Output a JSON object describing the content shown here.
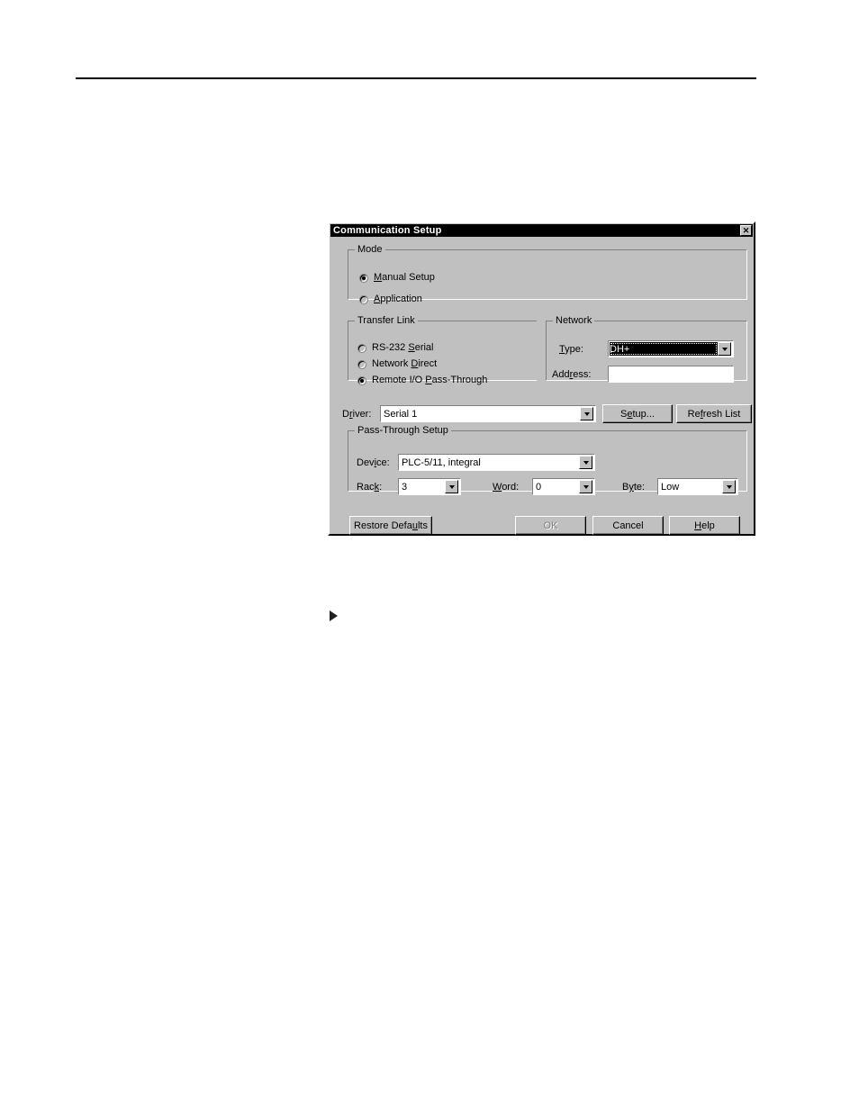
{
  "page": {
    "rule": "horizontal-rule",
    "bullet": "▶"
  },
  "dialog": {
    "title": "Communication Setup",
    "close_glyph": "✕",
    "mode": {
      "legend": "Mode",
      "options": [
        {
          "label_pre": "",
          "label_mnemonic": "M",
          "label_post": "anual Setup",
          "selected": true
        },
        {
          "label_pre": "",
          "label_mnemonic": "A",
          "label_post": "pplication",
          "selected": false
        }
      ]
    },
    "transfer_link": {
      "legend": "Transfer Link",
      "options": [
        {
          "label_pre": "RS-232 ",
          "label_mnemonic": "S",
          "label_post": "erial",
          "selected": false
        },
        {
          "label_pre": "Network ",
          "label_mnemonic": "D",
          "label_post": "irect",
          "selected": false
        },
        {
          "label_pre": "Remote I/O ",
          "label_mnemonic": "P",
          "label_post": "ass-Through",
          "selected": true
        }
      ]
    },
    "network": {
      "legend": "Network",
      "type_label_pre": "",
      "type_label_mnemonic": "T",
      "type_label_post": "ype:",
      "type_value": "DH+",
      "address_label_pre": "Add",
      "address_label_mnemonic": "r",
      "address_label_post": "ess:",
      "address_value": ""
    },
    "driver": {
      "label_pre": "D",
      "label_mnemonic": "r",
      "label_post": "iver:",
      "value": "Serial 1",
      "setup_pre": "S",
      "setup_mnemonic": "e",
      "setup_post": "tup...",
      "refresh_pre": "Re",
      "refresh_mnemonic": "f",
      "refresh_post": "resh List"
    },
    "pass_through": {
      "legend": "Pass-Through Setup",
      "device_label_pre": "Dev",
      "device_label_mnemonic": "i",
      "device_label_post": "ce:",
      "device_value": "PLC-5/11, integral",
      "rack_label_pre": "Rac",
      "rack_label_mnemonic": "k",
      "rack_label_post": ":",
      "rack_value": "3",
      "word_label_pre": "",
      "word_label_mnemonic": "W",
      "word_label_post": "ord:",
      "word_value": "0",
      "byte_label_pre": "B",
      "byte_label_mnemonic": "y",
      "byte_label_post": "te:",
      "byte_value": "Low"
    },
    "buttons": {
      "restore_pre": "Restore Defa",
      "restore_mnemonic": "u",
      "restore_post": "lts",
      "ok": "OK",
      "ok_disabled": true,
      "cancel": "Cancel",
      "help_pre": "",
      "help_mnemonic": "H",
      "help_post": "elp"
    }
  },
  "colors": {
    "face": "#c0c0c0",
    "titlebar": "#000000",
    "titlebar_text": "#ffffff",
    "field": "#ffffff",
    "disabled_text": "#808080"
  }
}
